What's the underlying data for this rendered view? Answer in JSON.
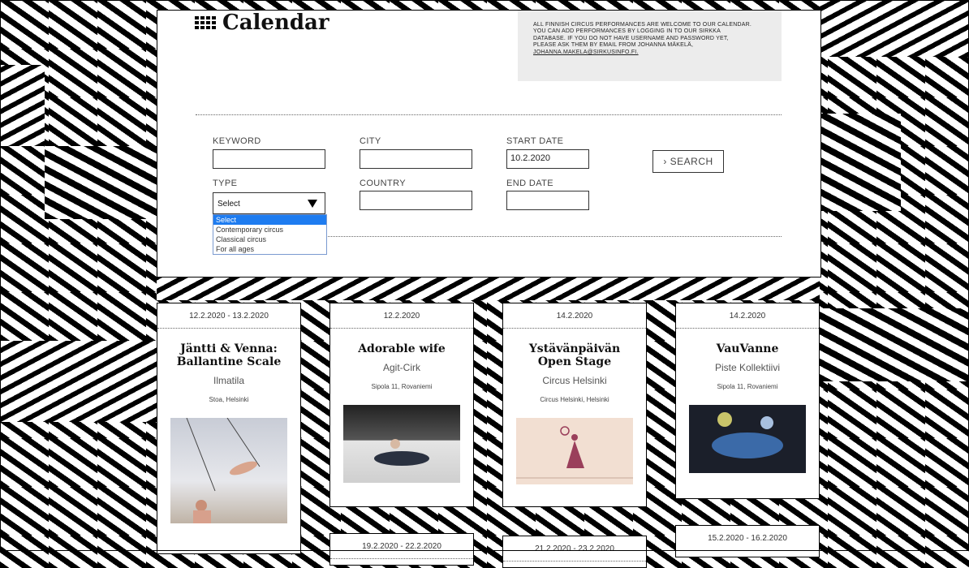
{
  "header": {
    "title": "Calendar",
    "notice_lines": [
      "ALL FINNISH CIRCUS PERFORMANCES ARE WELCOME TO OUR CALENDAR.",
      "YOU CAN ADD PERFORMANCES BY LOGGING IN TO OUR SIRKKA",
      "DATABASE. IF YOU DO NOT HAVE USERNAME AND PASSWORD YET,",
      "PLEASE ASK THEM BY EMAIL FROM JOHANNA MÄKELÄ,"
    ],
    "notice_email": "JOHANNA.MAKELA@SIRKUSINFO.FI."
  },
  "search": {
    "keyword_label": "KEYWORD",
    "keyword_value": "",
    "city_label": "CITY",
    "city_value": "",
    "start_label": "START DATE",
    "start_value": "10.2.2020",
    "type_label": "TYPE",
    "type_value": "Select",
    "country_label": "COUNTRY",
    "country_value": "",
    "end_label": "END DATE",
    "end_value": "",
    "search_button": "› SEARCH",
    "type_options": [
      "Select",
      "Contemporary circus",
      "Classical circus",
      "For all ages"
    ]
  },
  "events": [
    {
      "date": "12.2.2020 - 13.2.2020",
      "title": "Jäntti & Venna: Ballantine Scale",
      "org": "Ilmatila",
      "location": "Stoa, Helsinki"
    },
    {
      "date": "12.2.2020",
      "title": "Adorable wife",
      "org": "Agit-Cirk",
      "location": "Sipola 11, Rovaniemi"
    },
    {
      "date": "14.2.2020",
      "title": "Ystävänpäivän Open Stage",
      "org": "Circus Helsinki",
      "location": "Circus Helsinki, Helsinki"
    },
    {
      "date": "14.2.2020",
      "title": "VauVanne",
      "org": "Piste Kollektiivi",
      "location": "Sipola 11, Rovaniemi"
    }
  ],
  "more_events": [
    {
      "date": "19.2.2020 - 22.2.2020"
    },
    {
      "date": "21.2.2020 - 23.2.2020"
    },
    {
      "date": "15.2.2020 - 16.2.2020"
    }
  ],
  "colors": {
    "highlight": "#1e7cf0",
    "notice_bg": "#ececec"
  }
}
